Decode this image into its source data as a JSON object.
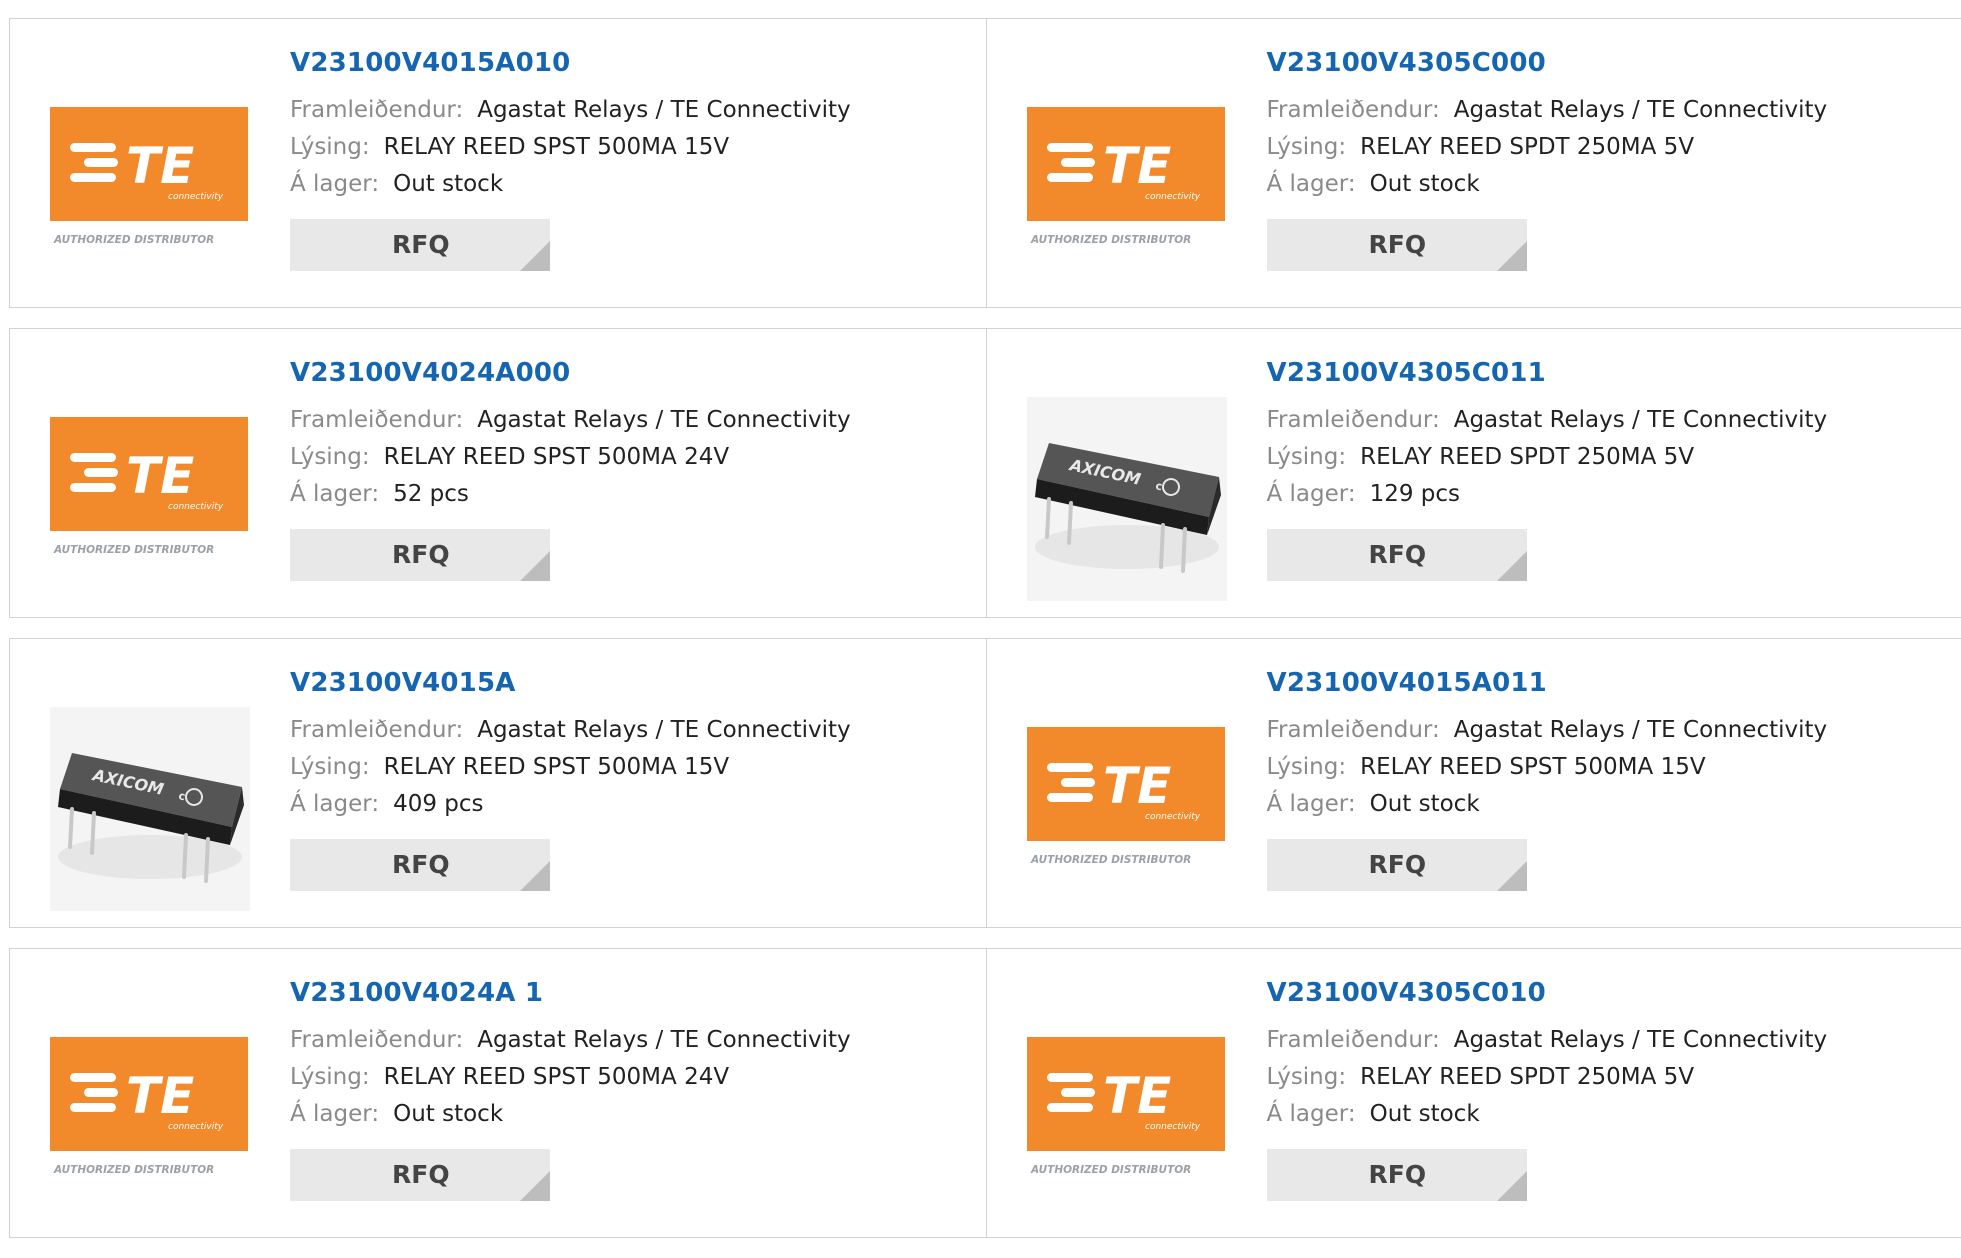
{
  "labels": {
    "manufacturer": "Framleiðendur:",
    "description": "Lýsing:",
    "stock": "Á lager:",
    "rfq": "RFQ",
    "logo_sub": "connectivity",
    "logo_footer": "AUTHORIZED DISTRIBUTOR",
    "relay_brand": "AXICOM"
  },
  "colors": {
    "part_link": "#1565b0",
    "te_orange": "#f2892b",
    "border": "#d2d2d2",
    "rfq_bg": "#e8e8e8"
  },
  "products": [
    {
      "part": "V23100V4015A010",
      "manufacturer": "Agastat Relays / TE Connectivity",
      "description": "RELAY REED SPST 500MA 15V",
      "stock": "Out stock",
      "image": "te-logo"
    },
    {
      "part": "V23100V4305C000",
      "manufacturer": "Agastat Relays / TE Connectivity",
      "description": "RELAY REED SPDT 250MA 5V",
      "stock": "Out stock",
      "image": "te-logo"
    },
    {
      "part": "V23100V4024A000",
      "manufacturer": "Agastat Relays / TE Connectivity",
      "description": "RELAY REED SPST 500MA 24V",
      "stock": "52 pcs",
      "image": "te-logo"
    },
    {
      "part": "V23100V4305C011",
      "manufacturer": "Agastat Relays / TE Connectivity",
      "description": "RELAY REED SPDT 250MA 5V",
      "stock": "129 pcs",
      "image": "relay-photo"
    },
    {
      "part": "V23100V4015A",
      "manufacturer": "Agastat Relays / TE Connectivity",
      "description": "RELAY REED SPST 500MA 15V",
      "stock": "409 pcs",
      "image": "relay-photo"
    },
    {
      "part": "V23100V4015A011",
      "manufacturer": "Agastat Relays / TE Connectivity",
      "description": "RELAY REED SPST 500MA 15V",
      "stock": "Out stock",
      "image": "te-logo"
    },
    {
      "part": "V23100V4024A 1",
      "manufacturer": "Agastat Relays / TE Connectivity",
      "description": "RELAY REED SPST 500MA 24V",
      "stock": "Out stock",
      "image": "te-logo"
    },
    {
      "part": "V23100V4305C010",
      "manufacturer": "Agastat Relays / TE Connectivity",
      "description": "RELAY REED SPDT 250MA 5V",
      "stock": "Out stock",
      "image": "te-logo"
    }
  ]
}
